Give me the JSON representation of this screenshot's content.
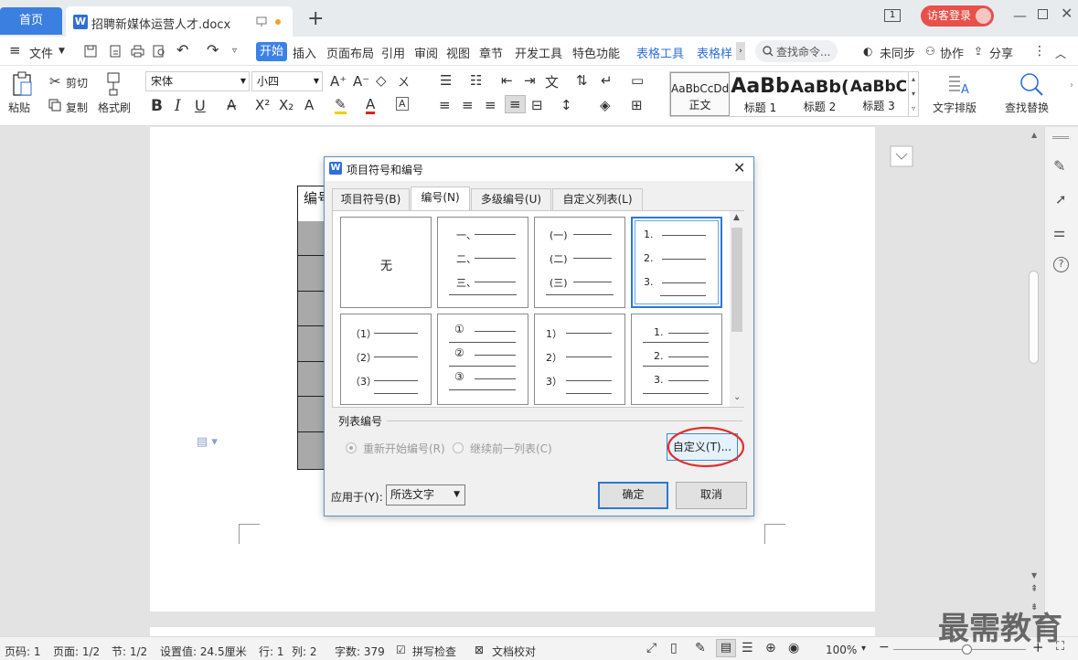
{
  "tabbar": {
    "home_tab": "首页",
    "doc_tab": "招聘新媒体运营人才.docx",
    "page_badge": "1",
    "login_button": "访客登录"
  },
  "menubar": {
    "file": "文件",
    "items": [
      "开始",
      "插入",
      "页面布局",
      "引用",
      "审阅",
      "视图",
      "章节",
      "开发工具",
      "特色功能"
    ],
    "context_items": [
      "表格工具",
      "表格样"
    ],
    "search_placeholder": "查找命令...",
    "sync": "未同步",
    "collab": "协作",
    "share": "分享"
  },
  "ribbon": {
    "paste": "粘贴",
    "cut": "剪切",
    "copy": "复制",
    "format_painter": "格式刷",
    "font_name": "宋体",
    "font_size": "小四",
    "styles": [
      {
        "preview": "AaBbCcDd",
        "label": "正文"
      },
      {
        "preview": "AaBb",
        "label": "标题 1"
      },
      {
        "preview": "AaBb(",
        "label": "标题 2"
      },
      {
        "preview": "AaBbC",
        "label": "标题 3"
      }
    ],
    "text_layout": "文字排版",
    "find_replace": "查找替换"
  },
  "document": {
    "table_header_cell": "编号"
  },
  "dialog": {
    "title": "项目符号和编号",
    "tabs": [
      "项目符号(B)",
      "编号(N)",
      "多级编号(U)",
      "自定义列表(L)"
    ],
    "active_tab_index": 1,
    "none_label": "无",
    "grid": [
      [
        "无"
      ],
      [
        "一、",
        "二、",
        "三、"
      ],
      [
        "(一)",
        "(二)",
        "(三)"
      ],
      [
        "1.",
        "2.",
        "3."
      ],
      [
        "（1）",
        "（2）",
        "（3）"
      ],
      [
        "①",
        "②",
        "③"
      ],
      [
        "1）",
        "2）",
        "3）"
      ],
      [
        "1.",
        "2.",
        "3."
      ]
    ],
    "selected_index": 3,
    "list_numbering_label": "列表编号",
    "restart_label": "重新开始编号(R)",
    "continue_label": "继续前一列表(C)",
    "custom_button": "自定义(T)...",
    "apply_to_label": "应用于(Y):",
    "apply_to_value": "所选文字",
    "ok_button": "确定",
    "cancel_button": "取消"
  },
  "status": {
    "page": "页码: 1",
    "pages": "页面: 1/2",
    "section": "节: 1/2",
    "setting": "设置值: 24.5厘米",
    "line": "行: 1",
    "col": "列: 2",
    "words": "字数: 379",
    "spell": "拼写检查",
    "proof": "文档校对",
    "zoom": "100%",
    "zoom_fraction": 0.55
  },
  "watermark": "最需教育",
  "colors": {
    "accent": "#3b7fe0",
    "login": "#e8504a",
    "highlight_circle": "#e0302b"
  }
}
